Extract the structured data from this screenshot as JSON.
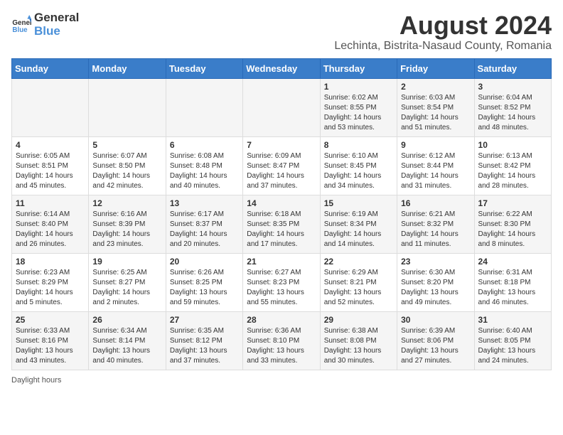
{
  "logo": {
    "general": "General",
    "blue": "Blue"
  },
  "title": "August 2024",
  "subtitle": "Lechinta, Bistrita-Nasaud County, Romania",
  "headers": [
    "Sunday",
    "Monday",
    "Tuesday",
    "Wednesday",
    "Thursday",
    "Friday",
    "Saturday"
  ],
  "weeks": [
    [
      {
        "num": "",
        "info": ""
      },
      {
        "num": "",
        "info": ""
      },
      {
        "num": "",
        "info": ""
      },
      {
        "num": "",
        "info": ""
      },
      {
        "num": "1",
        "info": "Sunrise: 6:02 AM\nSunset: 8:55 PM\nDaylight: 14 hours and 53 minutes."
      },
      {
        "num": "2",
        "info": "Sunrise: 6:03 AM\nSunset: 8:54 PM\nDaylight: 14 hours and 51 minutes."
      },
      {
        "num": "3",
        "info": "Sunrise: 6:04 AM\nSunset: 8:52 PM\nDaylight: 14 hours and 48 minutes."
      }
    ],
    [
      {
        "num": "4",
        "info": "Sunrise: 6:05 AM\nSunset: 8:51 PM\nDaylight: 14 hours and 45 minutes."
      },
      {
        "num": "5",
        "info": "Sunrise: 6:07 AM\nSunset: 8:50 PM\nDaylight: 14 hours and 42 minutes."
      },
      {
        "num": "6",
        "info": "Sunrise: 6:08 AM\nSunset: 8:48 PM\nDaylight: 14 hours and 40 minutes."
      },
      {
        "num": "7",
        "info": "Sunrise: 6:09 AM\nSunset: 8:47 PM\nDaylight: 14 hours and 37 minutes."
      },
      {
        "num": "8",
        "info": "Sunrise: 6:10 AM\nSunset: 8:45 PM\nDaylight: 14 hours and 34 minutes."
      },
      {
        "num": "9",
        "info": "Sunrise: 6:12 AM\nSunset: 8:44 PM\nDaylight: 14 hours and 31 minutes."
      },
      {
        "num": "10",
        "info": "Sunrise: 6:13 AM\nSunset: 8:42 PM\nDaylight: 14 hours and 28 minutes."
      }
    ],
    [
      {
        "num": "11",
        "info": "Sunrise: 6:14 AM\nSunset: 8:40 PM\nDaylight: 14 hours and 26 minutes."
      },
      {
        "num": "12",
        "info": "Sunrise: 6:16 AM\nSunset: 8:39 PM\nDaylight: 14 hours and 23 minutes."
      },
      {
        "num": "13",
        "info": "Sunrise: 6:17 AM\nSunset: 8:37 PM\nDaylight: 14 hours and 20 minutes."
      },
      {
        "num": "14",
        "info": "Sunrise: 6:18 AM\nSunset: 8:35 PM\nDaylight: 14 hours and 17 minutes."
      },
      {
        "num": "15",
        "info": "Sunrise: 6:19 AM\nSunset: 8:34 PM\nDaylight: 14 hours and 14 minutes."
      },
      {
        "num": "16",
        "info": "Sunrise: 6:21 AM\nSunset: 8:32 PM\nDaylight: 14 hours and 11 minutes."
      },
      {
        "num": "17",
        "info": "Sunrise: 6:22 AM\nSunset: 8:30 PM\nDaylight: 14 hours and 8 minutes."
      }
    ],
    [
      {
        "num": "18",
        "info": "Sunrise: 6:23 AM\nSunset: 8:29 PM\nDaylight: 14 hours and 5 minutes."
      },
      {
        "num": "19",
        "info": "Sunrise: 6:25 AM\nSunset: 8:27 PM\nDaylight: 14 hours and 2 minutes."
      },
      {
        "num": "20",
        "info": "Sunrise: 6:26 AM\nSunset: 8:25 PM\nDaylight: 13 hours and 59 minutes."
      },
      {
        "num": "21",
        "info": "Sunrise: 6:27 AM\nSunset: 8:23 PM\nDaylight: 13 hours and 55 minutes."
      },
      {
        "num": "22",
        "info": "Sunrise: 6:29 AM\nSunset: 8:21 PM\nDaylight: 13 hours and 52 minutes."
      },
      {
        "num": "23",
        "info": "Sunrise: 6:30 AM\nSunset: 8:20 PM\nDaylight: 13 hours and 49 minutes."
      },
      {
        "num": "24",
        "info": "Sunrise: 6:31 AM\nSunset: 8:18 PM\nDaylight: 13 hours and 46 minutes."
      }
    ],
    [
      {
        "num": "25",
        "info": "Sunrise: 6:33 AM\nSunset: 8:16 PM\nDaylight: 13 hours and 43 minutes."
      },
      {
        "num": "26",
        "info": "Sunrise: 6:34 AM\nSunset: 8:14 PM\nDaylight: 13 hours and 40 minutes."
      },
      {
        "num": "27",
        "info": "Sunrise: 6:35 AM\nSunset: 8:12 PM\nDaylight: 13 hours and 37 minutes."
      },
      {
        "num": "28",
        "info": "Sunrise: 6:36 AM\nSunset: 8:10 PM\nDaylight: 13 hours and 33 minutes."
      },
      {
        "num": "29",
        "info": "Sunrise: 6:38 AM\nSunset: 8:08 PM\nDaylight: 13 hours and 30 minutes."
      },
      {
        "num": "30",
        "info": "Sunrise: 6:39 AM\nSunset: 8:06 PM\nDaylight: 13 hours and 27 minutes."
      },
      {
        "num": "31",
        "info": "Sunrise: 6:40 AM\nSunset: 8:05 PM\nDaylight: 13 hours and 24 minutes."
      }
    ]
  ],
  "legend": {
    "daylight_label": "Daylight hours"
  }
}
